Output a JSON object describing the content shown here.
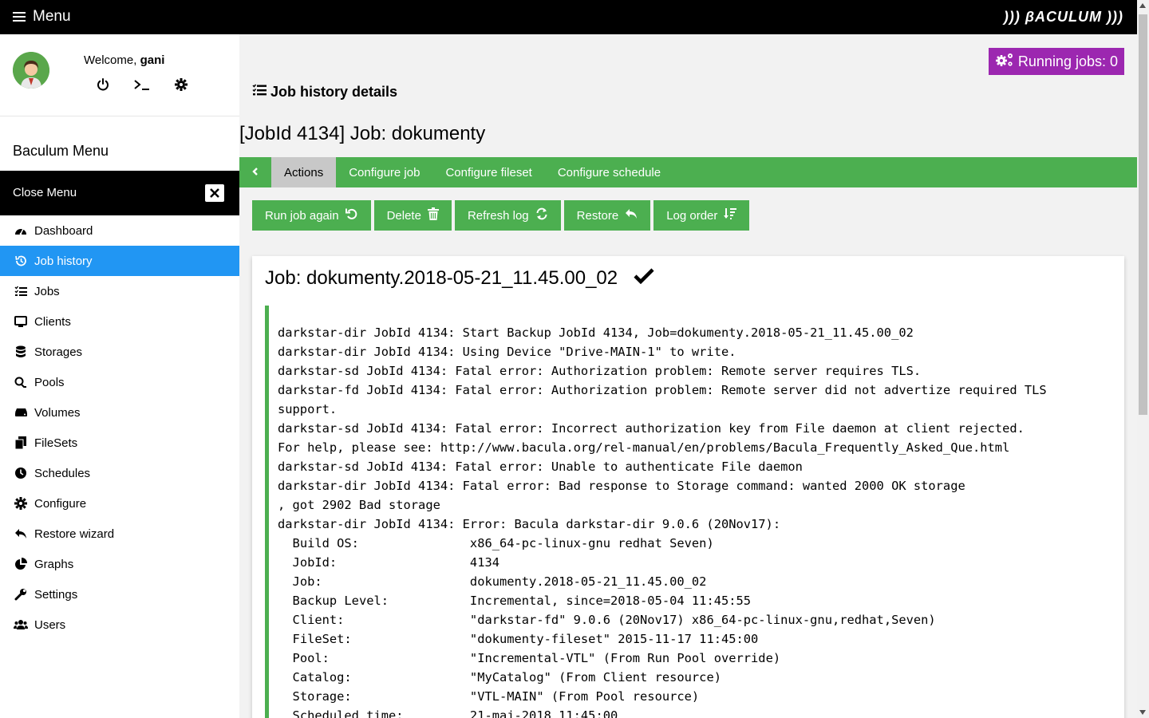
{
  "topbar": {
    "menu_label": "Menu",
    "brand": "))) βACULUM )))"
  },
  "user": {
    "welcome_prefix": "Welcome,",
    "username": "gani"
  },
  "sidebar": {
    "title": "Baculum Menu",
    "close_label": "Close Menu",
    "items": [
      {
        "label": "Dashboard",
        "icon": "dashboard-icon"
      },
      {
        "label": "Job history",
        "icon": "history-icon"
      },
      {
        "label": "Jobs",
        "icon": "tasks-icon"
      },
      {
        "label": "Clients",
        "icon": "desktop-icon"
      },
      {
        "label": "Storages",
        "icon": "database-icon"
      },
      {
        "label": "Pools",
        "icon": "pool-icon"
      },
      {
        "label": "Volumes",
        "icon": "hdd-icon"
      },
      {
        "label": "FileSets",
        "icon": "copy-icon"
      },
      {
        "label": "Schedules",
        "icon": "clock-icon"
      },
      {
        "label": "Configure",
        "icon": "cog-icon"
      },
      {
        "label": "Restore wizard",
        "icon": "reply-icon"
      },
      {
        "label": "Graphs",
        "icon": "pie-chart-icon"
      },
      {
        "label": "Settings",
        "icon": "wrench-icon"
      },
      {
        "label": "Users",
        "icon": "users-icon"
      }
    ],
    "active_item": "Job history"
  },
  "main": {
    "running_jobs": "Running jobs: 0",
    "page_heading": "Job history details",
    "job_title": "[JobId 4134] Job: dokumenty",
    "tabs": [
      "Actions",
      "Configure job",
      "Configure fileset",
      "Configure schedule"
    ],
    "active_tab": "Actions",
    "action_buttons": [
      "Run job again",
      "Delete",
      "Refresh log",
      "Restore",
      "Log order"
    ],
    "card_title": "Job: dokumenty.2018-05-21_11.45.00_02",
    "log": "darkstar-dir JobId 4134: Start Backup JobId 4134, Job=dokumenty.2018-05-21_11.45.00_02\ndarkstar-dir JobId 4134: Using Device \"Drive-MAIN-1\" to write.\ndarkstar-sd JobId 4134: Fatal error: Authorization problem: Remote server requires TLS.\ndarkstar-fd JobId 4134: Fatal error: Authorization problem: Remote server did not advertize required TLS\nsupport.\ndarkstar-sd JobId 4134: Fatal error: Incorrect authorization key from File daemon at client rejected.\nFor help, please see: http://www.bacula.org/rel-manual/en/problems/Bacula_Frequently_Asked_Que.html\ndarkstar-sd JobId 4134: Fatal error: Unable to authenticate File daemon\ndarkstar-dir JobId 4134: Fatal error: Bad response to Storage command: wanted 2000 OK storage\n, got 2902 Bad storage\ndarkstar-dir JobId 4134: Error: Bacula darkstar-dir 9.0.6 (20Nov17):\n  Build OS:               x86_64-pc-linux-gnu redhat Seven)\n  JobId:                  4134\n  Job:                    dokumenty.2018-05-21_11.45.00_02\n  Backup Level:           Incremental, since=2018-05-04 11:45:55\n  Client:                 \"darkstar-fd\" 9.0.6 (20Nov17) x86_64-pc-linux-gnu,redhat,Seven)\n  FileSet:                \"dokumenty-fileset\" 2015-11-17 11:45:00\n  Pool:                   \"Incremental-VTL\" (From Run Pool override)\n  Catalog:                \"MyCatalog\" (From Client resource)\n  Storage:                \"VTL-MAIN\" (From Pool resource)\n  Scheduled time:         21-maj-2018 11:45:00"
  },
  "colors": {
    "accent_green": "#4caf50",
    "active_blue": "#2196f3",
    "running_purple": "#9c27b0"
  }
}
